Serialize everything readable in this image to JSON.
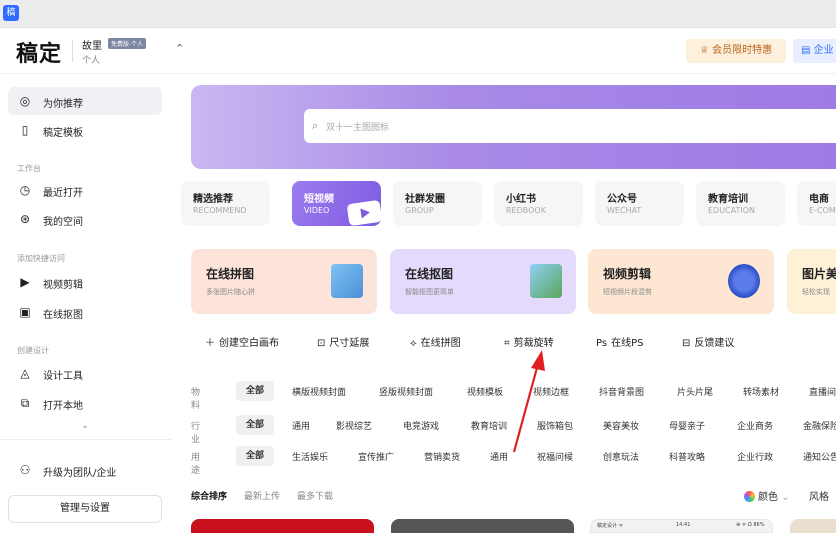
{
  "app": {
    "icon_label": "稿"
  },
  "header": {
    "logo": "稿定",
    "workspace_name": "故里",
    "workspace_badge": "免费版-个人",
    "workspace_type": "个人",
    "switch_icon": "up-down-chevron-icon",
    "vip_label": "会员限时特惠",
    "enterprise_label": "企业"
  },
  "sidebar": {
    "items_top": [
      {
        "label": "为你推荐",
        "icon": "compass-icon",
        "active": true
      },
      {
        "label": "稿定模板",
        "icon": "template-icon"
      }
    ],
    "section_workspace": "工作台",
    "items_workspace": [
      {
        "label": "最近打开",
        "icon": "clock-icon"
      },
      {
        "label": "我的空间",
        "icon": "user-space-icon"
      }
    ],
    "section_quick": "添加快捷访问",
    "items_quick": [
      {
        "label": "视频剪辑",
        "icon": "video-edit-icon"
      },
      {
        "label": "在线抠图",
        "icon": "cutout-icon"
      }
    ],
    "section_create": "创建设计",
    "items_create": [
      {
        "label": "设计工具",
        "icon": "design-tool-icon"
      },
      {
        "label": "打开本地",
        "icon": "open-local-icon"
      }
    ],
    "more_icon": "chevron-down-icon",
    "upgrade_label": "升级为团队/企业",
    "manage_label": "管理与设置"
  },
  "search": {
    "placeholder": "双十一主图图标"
  },
  "categories": [
    {
      "title": "精选推荐",
      "sub": "RECOMMEND"
    },
    {
      "title": "短视频",
      "sub": "VIDEO",
      "active": true
    },
    {
      "title": "社群发圈",
      "sub": "GROUP"
    },
    {
      "title": "小红书",
      "sub": "REDBOOK"
    },
    {
      "title": "公众号",
      "sub": "WECHAT"
    },
    {
      "title": "教育培训",
      "sub": "EDUCATION"
    },
    {
      "title": "电商",
      "sub": "E-COM"
    }
  ],
  "tools": [
    {
      "title": "在线拼图",
      "sub": "多张图片随心拼",
      "bg": "#fde4da"
    },
    {
      "title": "在线抠图",
      "sub": "智能抠图更简单",
      "bg": "#e4dafb"
    },
    {
      "title": "视频剪辑",
      "sub": "短视频片段混剪",
      "bg": "#fde7d2"
    },
    {
      "title": "图片美",
      "sub": "轻松实现",
      "bg": "#fdf1d6"
    }
  ],
  "quick_actions": [
    {
      "label": "创建空白画布",
      "icon": "plus-icon"
    },
    {
      "label": "尺寸延展",
      "icon": "resize-icon"
    },
    {
      "label": "在线拼图",
      "icon": "puzzle-icon"
    },
    {
      "label": "剪裁旋转",
      "icon": "crop-icon"
    },
    {
      "label": "在线PS",
      "icon": "ps-icon"
    },
    {
      "label": "反馈建议",
      "icon": "feedback-icon"
    }
  ],
  "filters": [
    {
      "label": "物料",
      "items": [
        "全部",
        "横版视频封面",
        "竖版视频封面",
        "视频模板",
        "视频边框",
        "抖音背景图",
        "片头片尾",
        "转场素材",
        "直播间"
      ]
    },
    {
      "label": "行业",
      "items": [
        "全部",
        "通用",
        "影视综艺",
        "电竞游戏",
        "教育培训",
        "服饰箱包",
        "美容美妆",
        "母婴亲子",
        "企业商务",
        "金融保险"
      ]
    },
    {
      "label": "用途",
      "items": [
        "全部",
        "生活娱乐",
        "宣传推广",
        "营销卖货",
        "通用",
        "祝福问候",
        "创意玩法",
        "科普攻略",
        "企业行政",
        "通知公告"
      ]
    }
  ],
  "sort": {
    "options": [
      "综合排序",
      "最新上传",
      "最多下载"
    ],
    "color_label": "颜色",
    "style_label": "风格"
  },
  "thumb_status": {
    "left": "稿定设计 ᯤ",
    "time": "14:41",
    "right": "⊕ ᯤ Ω 86%"
  }
}
